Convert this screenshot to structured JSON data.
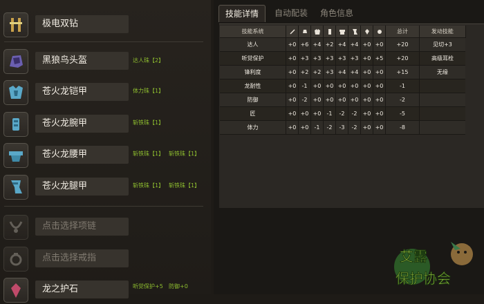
{
  "equipment": [
    {
      "name": "极电双钻",
      "gems": []
    },
    {
      "name": "黑狼鸟头盔",
      "gems": [
        "达人珠【2】"
      ]
    },
    {
      "name": "苍火龙铠甲",
      "gems": [
        "体力珠【1】"
      ]
    },
    {
      "name": "苍火龙腕甲",
      "gems": [
        "斩铁珠【1】"
      ]
    },
    {
      "name": "苍火龙腰甲",
      "gems": [
        "斩铁珠【1】",
        "斩铁珠【1】"
      ]
    },
    {
      "name": "苍火龙腿甲",
      "gems": [
        "斩铁珠【1】",
        "斩铁珠【1】"
      ]
    }
  ],
  "accessories": [
    {
      "name": "点击选择项链"
    },
    {
      "name": "点击选择戒指"
    },
    {
      "name": "龙之护石",
      "gems": [
        "听觉保护+5",
        "防御+0"
      ]
    }
  ],
  "tabs": [
    "技能详情",
    "自动配装",
    "角色信息"
  ],
  "table": {
    "header_name": "技能系统",
    "header_total": "总计",
    "header_skill": "发动技能",
    "column_icons": [
      "weapon-icon",
      "helm-icon",
      "chest-icon",
      "arm-icon",
      "waist-icon",
      "leg-icon",
      "charm-icon",
      "gem-icon"
    ],
    "rows": [
      {
        "name": "达人",
        "vals": [
          "+0",
          "+6",
          "+4",
          "+2",
          "+4",
          "+4",
          "+0",
          "+0"
        ],
        "total": "+20",
        "skill": "见切+3"
      },
      {
        "name": "听觉保护",
        "vals": [
          "+0",
          "+3",
          "+3",
          "+3",
          "+3",
          "+3",
          "+0",
          "+5"
        ],
        "total": "+20",
        "skill": "高级耳栓"
      },
      {
        "name": "锋利度",
        "vals": [
          "+0",
          "+2",
          "+2",
          "+3",
          "+4",
          "+4",
          "+0",
          "+0"
        ],
        "total": "+15",
        "skill": "无缘"
      },
      {
        "name": "龙耐性",
        "vals": [
          "+0",
          "-1",
          "+0",
          "+0",
          "+0",
          "+0",
          "+0",
          "+0"
        ],
        "total": "-1",
        "skill": ""
      },
      {
        "name": "防御",
        "vals": [
          "+0",
          "-2",
          "+0",
          "+0",
          "+0",
          "+0",
          "+0",
          "+0"
        ],
        "total": "-2",
        "skill": ""
      },
      {
        "name": "匠",
        "vals": [
          "+0",
          "+0",
          "+0",
          "-1",
          "-2",
          "-2",
          "+0",
          "+0"
        ],
        "total": "-5",
        "skill": ""
      },
      {
        "name": "体力",
        "vals": [
          "+0",
          "+0",
          "-1",
          "-2",
          "-3",
          "-2",
          "+0",
          "+0"
        ],
        "total": "-8",
        "skill": ""
      }
    ]
  },
  "watermark": "艾露 保护协会"
}
